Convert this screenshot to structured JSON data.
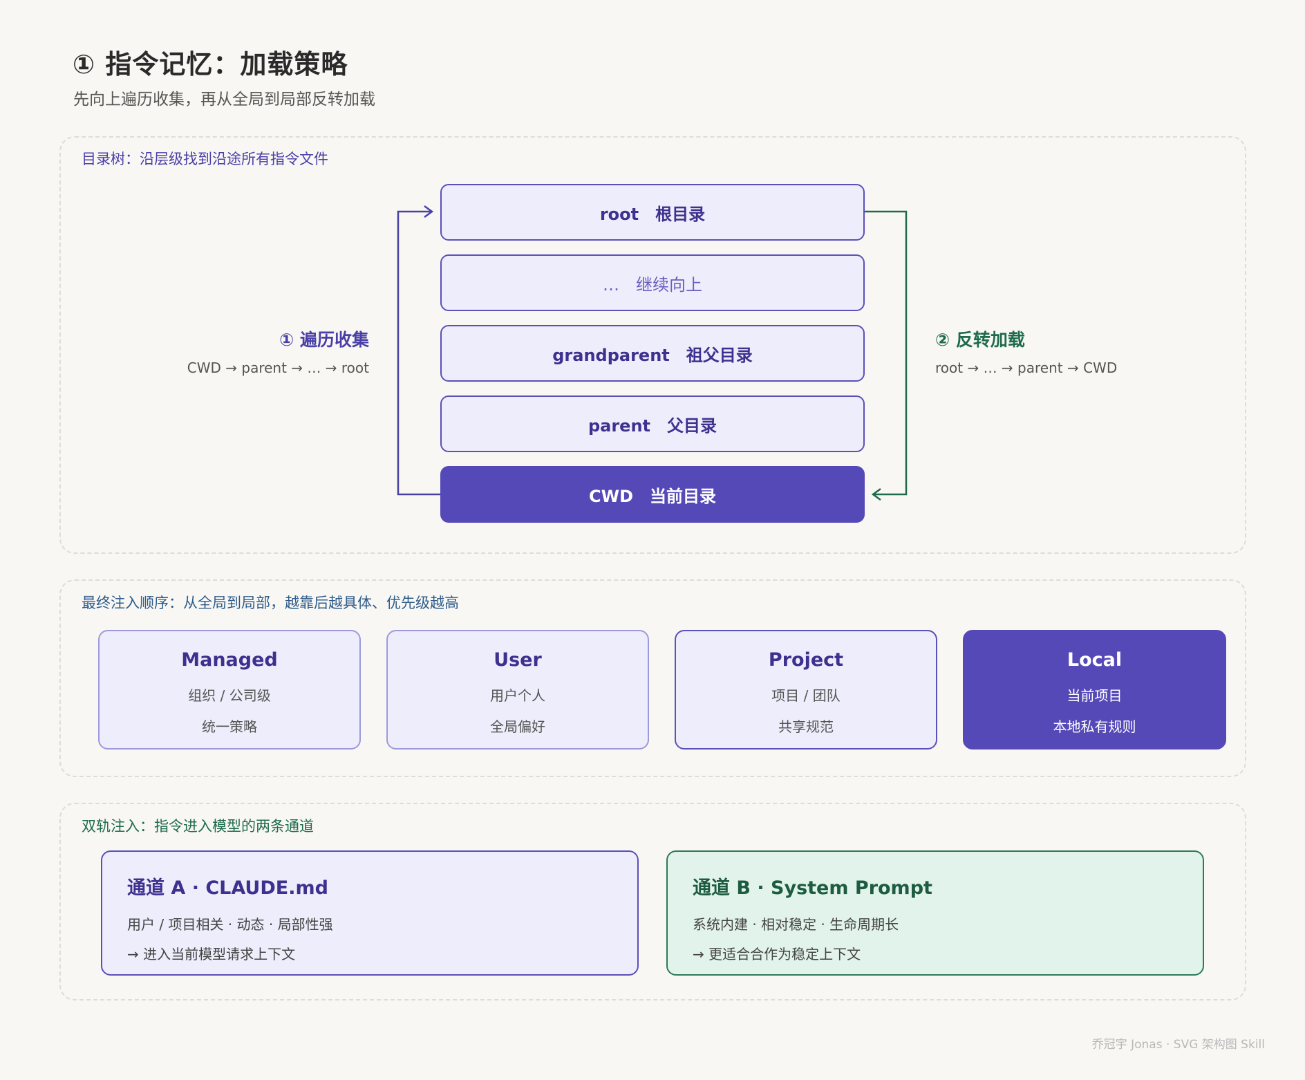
{
  "header": {
    "title": "① 指令记忆：加载策略",
    "subtitle": "先向上遍历收集，再从全局到局部反转加载"
  },
  "tree_section": {
    "label": "目录树：沿层级找到沿途所有指令文件",
    "nodes": [
      {
        "text": "root　根目录"
      },
      {
        "text": "…　继续向上"
      },
      {
        "text": "grandparent　祖父目录"
      },
      {
        "text": "parent　父目录"
      },
      {
        "text": "CWD　当前目录"
      }
    ],
    "left": {
      "title": "① 遍历收集",
      "sub": "CWD → parent → … → root"
    },
    "right": {
      "title": "② 反转加载",
      "sub": "root → … → parent → CWD"
    }
  },
  "order_section": {
    "label": "最终注入顺序：从全局到局部，越靠后越具体、优先级越高",
    "cards": [
      {
        "title": "Managed",
        "line1": "组织 / 公司级",
        "line2": "统一策略"
      },
      {
        "title": "User",
        "line1": "用户个人",
        "line2": "全局偏好"
      },
      {
        "title": "Project",
        "line1": "项目 / 团队",
        "line2": "共享规范"
      },
      {
        "title": "Local",
        "line1": "当前项目",
        "line2": "本地私有规则"
      }
    ]
  },
  "channel_section": {
    "label": "双轨注入：指令进入模型的两条通道",
    "a": {
      "title": "通道 A · CLAUDE.md",
      "line1": "用户 / 项目相关 · 动态 · 局部性强",
      "line2": "→ 进入当前模型请求上下文"
    },
    "b": {
      "title": "通道 B · System Prompt",
      "line1": "系统内建 · 相对稳定 · 生命周期长",
      "line2": "→ 更适合合作为稳定上下文"
    }
  },
  "footer": "乔冠宇 Jonas · SVG 架构图 Skill",
  "colors": {
    "purple": "#5549b8",
    "purple_light": "#eeedfb",
    "green": "#1d6b4a",
    "green_light": "#e2f3ec",
    "background": "#f8f7f4"
  }
}
